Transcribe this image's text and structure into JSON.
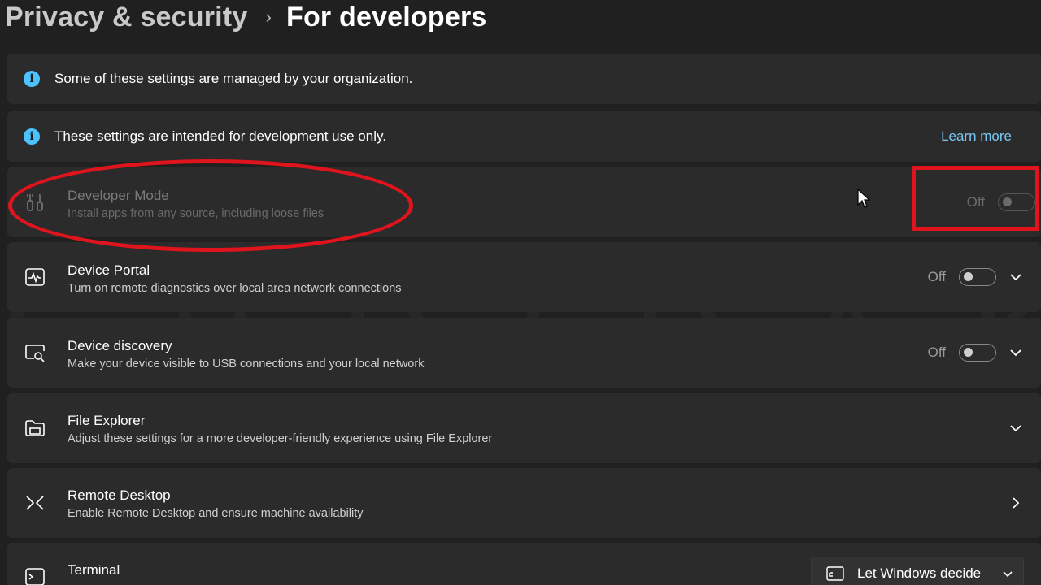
{
  "breadcrumb": {
    "parent": "Privacy & security",
    "separator": "›",
    "current": "For developers"
  },
  "banners": [
    {
      "text": "Some of these settings are managed by your organization.",
      "icon": "info-icon"
    },
    {
      "text": "These settings are intended for development use only.",
      "icon": "info-icon",
      "link": "Learn more"
    }
  ],
  "settings": {
    "developer_mode": {
      "title": "Developer Mode",
      "description": "Install apps from any source, including loose files",
      "state": "Off",
      "icon": "tools-icon",
      "disabled": true
    },
    "device_portal": {
      "title": "Device Portal",
      "description": "Turn on remote diagnostics over local area network connections",
      "state": "Off",
      "icon": "pulse-monitor-icon"
    },
    "device_discovery": {
      "title": "Device discovery",
      "description": "Make your device visible to USB connections and your local network",
      "state": "Off",
      "icon": "device-search-icon"
    },
    "file_explorer": {
      "title": "File Explorer",
      "description": "Adjust these settings for a more developer-friendly experience using File Explorer",
      "icon": "folder-icon"
    },
    "remote_desktop": {
      "title": "Remote Desktop",
      "description": "Enable Remote Desktop and ensure machine availability",
      "icon": "remote-desktop-icon"
    },
    "terminal": {
      "title": "Terminal",
      "icon": "terminal-icon",
      "select_value": "Let Windows decide"
    }
  },
  "colors": {
    "background": "#202020",
    "card": "#2b2b2b",
    "accent": "#4cc2ff",
    "link": "#7ac7f5",
    "annotation": "#e0141d"
  }
}
